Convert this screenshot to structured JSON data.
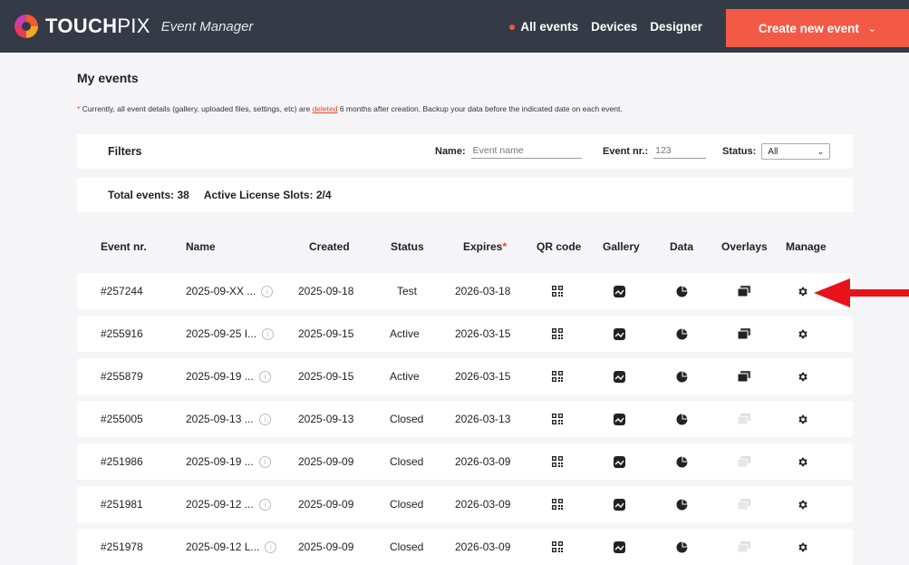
{
  "app": {
    "brand_bold": "TOUCH",
    "brand_light": "PIX",
    "subtitle": "Event Manager"
  },
  "nav": {
    "items": [
      "All events",
      "Devices",
      "Designer"
    ],
    "active_index": 0,
    "create_label": "Create new event"
  },
  "page": {
    "title": "My events",
    "notice_prefix": "Currently, all event details (gallery, uploaded files, settings, etc) are",
    "notice_link": "deleted",
    "notice_suffix": "6 months after creation. Backup your data before the indicated date on each event."
  },
  "filters": {
    "title": "Filters",
    "name_label": "Name:",
    "name_placeholder": "Event name",
    "nr_label": "Event nr.:",
    "nr_placeholder": "123",
    "status_label": "Status:",
    "status_value": "All"
  },
  "totals": {
    "events": "Total events: 38",
    "slots": "Active License Slots: 2/4"
  },
  "table": {
    "headers": {
      "nr": "Event nr.",
      "name": "Name",
      "created": "Created",
      "status": "Status",
      "expires": "Expires",
      "qr": "QR code",
      "gallery": "Gallery",
      "data": "Data",
      "overlays": "Overlays",
      "manage": "Manage"
    },
    "rows": [
      {
        "nr": "#257244",
        "name": "2025-09-XX ...",
        "created": "2025-09-18",
        "status": "Test",
        "expires": "2026-03-18",
        "overlays_active": true
      },
      {
        "nr": "#255916",
        "name": "2025-09-25 I...",
        "created": "2025-09-15",
        "status": "Active",
        "expires": "2026-03-15",
        "overlays_active": true
      },
      {
        "nr": "#255879",
        "name": "2025-09-19 ...",
        "created": "2025-09-15",
        "status": "Active",
        "expires": "2026-03-15",
        "overlays_active": true
      },
      {
        "nr": "#255005",
        "name": "2025-09-13 ...",
        "created": "2025-09-13",
        "status": "Closed",
        "expires": "2026-03-13",
        "overlays_active": false
      },
      {
        "nr": "#251986",
        "name": "2025-09-19 ...",
        "created": "2025-09-09",
        "status": "Closed",
        "expires": "2026-03-09",
        "overlays_active": false
      },
      {
        "nr": "#251981",
        "name": "2025-09-12 ...",
        "created": "2025-09-09",
        "status": "Closed",
        "expires": "2026-03-09",
        "overlays_active": false
      },
      {
        "nr": "#251978",
        "name": "2025-09-12 L...",
        "created": "2025-09-09",
        "status": "Closed",
        "expires": "2026-03-09",
        "overlays_active": false
      }
    ]
  },
  "colors": {
    "topbar": "#353a47",
    "accent": "#f25a45",
    "arrow": "#e8131a"
  }
}
